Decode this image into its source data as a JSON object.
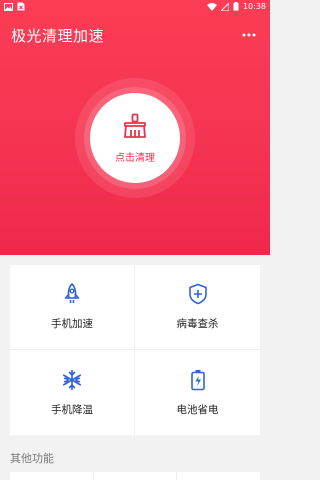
{
  "status_bar": {
    "time": "10:38"
  },
  "app": {
    "title": "极光清理加速"
  },
  "clean": {
    "label": "点击清理"
  },
  "features": [
    {
      "label": "手机加速",
      "icon": "rocket-icon"
    },
    {
      "label": "病毒查杀",
      "icon": "shield-plus-icon"
    },
    {
      "label": "手机降温",
      "icon": "snowflake-icon"
    },
    {
      "label": "电池省电",
      "icon": "battery-charging-icon"
    }
  ],
  "sections": {
    "other": "其他功能"
  },
  "colors": {
    "accent": "#f53451",
    "icon_blue": "#2f63d6",
    "background": "#f2f2f2"
  }
}
